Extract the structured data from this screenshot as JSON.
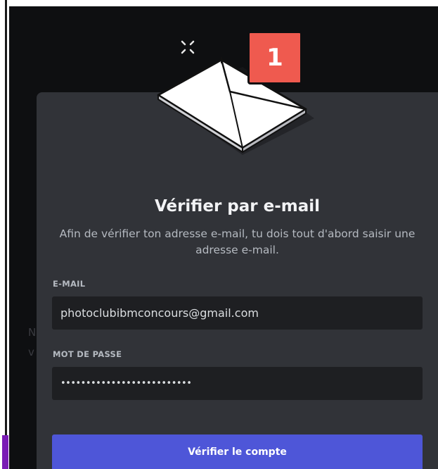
{
  "notification_badge": {
    "count": "1"
  },
  "modal": {
    "title": "Vérifier par e-mail",
    "subtitle": "Afin de vérifier ton adresse e-mail, tu dois tout d'abord saisir une adresse e-mail."
  },
  "form": {
    "email_label": "E-MAIL",
    "email_value": "photoclubibmconcours@gmail.com",
    "password_label": "MOT DE PASSE",
    "password_value": "••••••••••••••••••••••••••",
    "submit_label": "Vérifier le compte"
  },
  "colors": {
    "backdrop": "#0e0f11",
    "modal_bg": "#313338",
    "input_bg": "#1e1f22",
    "button": "#4e56d8",
    "badge": "#ef5a4f"
  },
  "icons": [
    "envelope-icon",
    "sparkle-icon"
  ]
}
